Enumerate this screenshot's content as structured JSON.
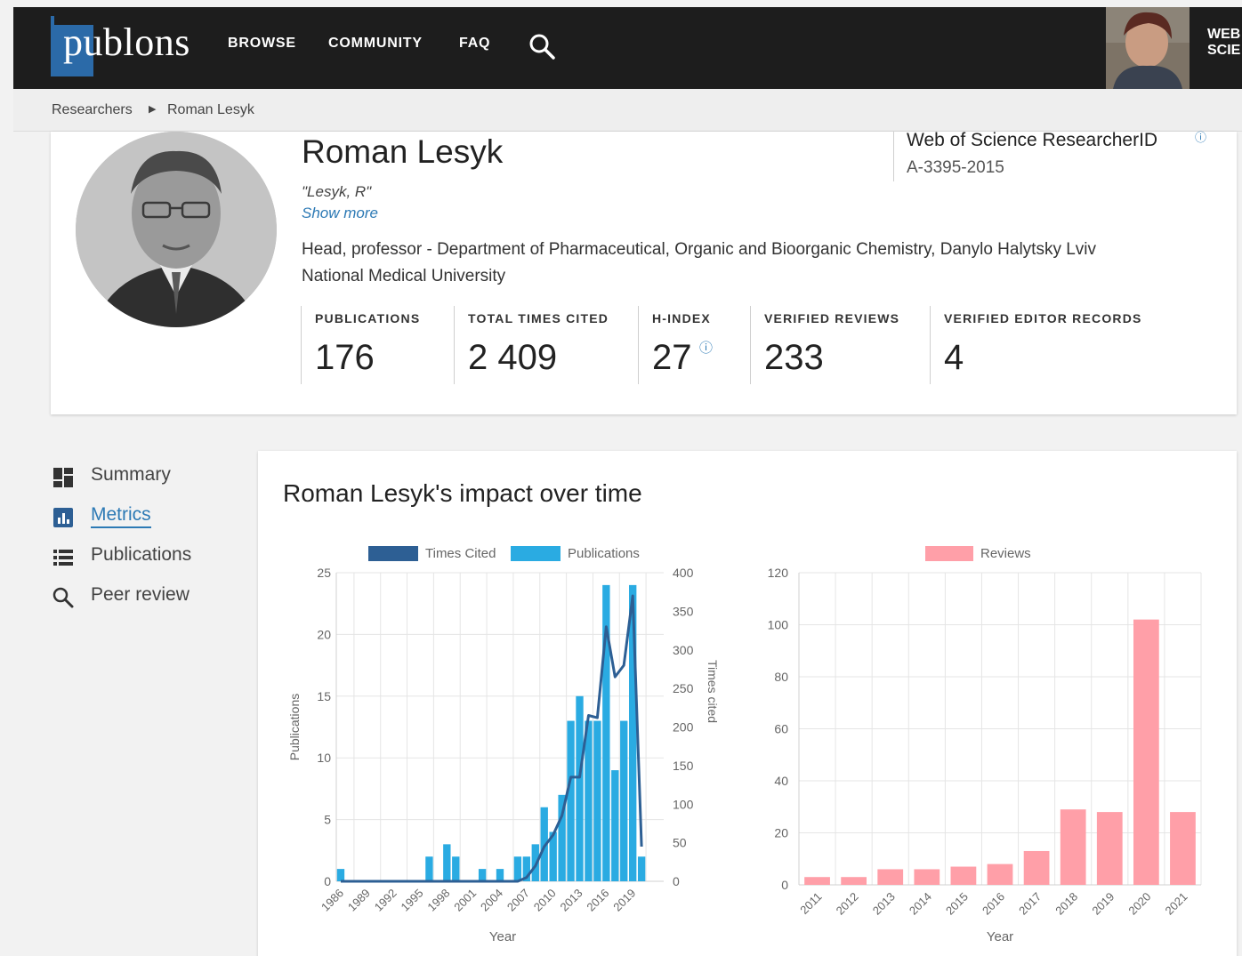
{
  "header": {
    "logo_text": "publons",
    "nav": [
      {
        "label": "BROWSE"
      },
      {
        "label": "COMMUNITY"
      },
      {
        "label": "FAQ"
      }
    ],
    "wos_line1": "WEB",
    "wos_line2": "SCIE"
  },
  "breadcrumb": {
    "parent": "Researchers",
    "current": "Roman Lesyk"
  },
  "profile": {
    "name": "Roman Lesyk",
    "alias": "\"Lesyk, R\"",
    "show_more": "Show more",
    "affiliation": "Head, professor - Department of Pharmaceutical, Organic and Bioorganic Chemistry, Danylo Halytsky Lviv National Medical University",
    "researcher_id_label": "Web of Science ResearcherID",
    "researcher_id_value": "A-3395-2015",
    "stats": [
      {
        "label": "PUBLICATIONS",
        "value": "176"
      },
      {
        "label": "TOTAL TIMES CITED",
        "value": "2 409"
      },
      {
        "label": "H-INDEX",
        "value": "27"
      },
      {
        "label": "VERIFIED REVIEWS",
        "value": "233"
      },
      {
        "label": "VERIFIED EDITOR RECORDS",
        "value": "4"
      }
    ]
  },
  "sidebar": {
    "items": [
      {
        "label": "Summary",
        "icon": "summary-icon"
      },
      {
        "label": "Metrics",
        "icon": "metrics-icon",
        "active": true
      },
      {
        "label": "Publications",
        "icon": "list-icon"
      },
      {
        "label": "Peer review",
        "icon": "search-icon"
      }
    ]
  },
  "metrics": {
    "title": "Roman Lesyk's impact over time"
  },
  "colors": {
    "times_cited": "#2d5f94",
    "publications": "#2aabe2",
    "reviews": "#ff9fa8",
    "link": "#2d7ab5"
  },
  "chart_data": [
    {
      "type": "bar",
      "legend": [
        "Times Cited",
        "Publications"
      ],
      "xlabel": "Year",
      "ylabel": "Publications",
      "y2label": "Times cited",
      "ylim": [
        0,
        25
      ],
      "y2lim": [
        0,
        400
      ],
      "yticks": [
        0,
        5,
        10,
        15,
        20,
        25
      ],
      "y2ticks": [
        0,
        50,
        100,
        150,
        200,
        250,
        300,
        350,
        400
      ],
      "x_tick_labels": [
        "1986",
        "1989",
        "1992",
        "1995",
        "1998",
        "2001",
        "2004",
        "2007",
        "2010",
        "2013",
        "2016",
        "2019"
      ],
      "x": [
        1986,
        1987,
        1988,
        1989,
        1990,
        1991,
        1992,
        1993,
        1994,
        1995,
        1996,
        1997,
        1998,
        1999,
        2000,
        2001,
        2002,
        2003,
        2004,
        2005,
        2006,
        2007,
        2008,
        2009,
        2010,
        2011,
        2012,
        2013,
        2014,
        2015,
        2016,
        2017,
        2018,
        2019,
        2020,
        2021,
        2022
      ],
      "series": [
        {
          "name": "Publications",
          "kind": "bar",
          "values": [
            1,
            0,
            0,
            0,
            0,
            0,
            0,
            0,
            0,
            0,
            2,
            0,
            3,
            2,
            0,
            0,
            1,
            0,
            1,
            0,
            2,
            2,
            3,
            6,
            4,
            7,
            13,
            15,
            13,
            13,
            24,
            9,
            13,
            24,
            2
          ]
        },
        {
          "name": "Times Cited",
          "kind": "line",
          "axis": "right",
          "values": [
            0,
            0,
            0,
            0,
            0,
            0,
            0,
            0,
            0,
            0,
            0,
            0,
            0,
            0,
            0,
            0,
            0,
            0,
            0,
            0,
            0,
            5,
            20,
            45,
            60,
            85,
            135,
            135,
            215,
            212,
            330,
            265,
            280,
            370,
            45
          ]
        }
      ]
    },
    {
      "type": "bar",
      "legend": [
        "Reviews"
      ],
      "xlabel": "Year",
      "ylabel": "",
      "ylim": [
        0,
        120
      ],
      "yticks": [
        0,
        20,
        40,
        60,
        80,
        100,
        120
      ],
      "categories": [
        "2011",
        "2012",
        "2013",
        "2014",
        "2015",
        "2016",
        "2017",
        "2018",
        "2019",
        "2020",
        "2021"
      ],
      "series": [
        {
          "name": "Reviews",
          "values": [
            3,
            3,
            6,
            6,
            7,
            8,
            13,
            29,
            28,
            102,
            28
          ]
        }
      ]
    }
  ]
}
